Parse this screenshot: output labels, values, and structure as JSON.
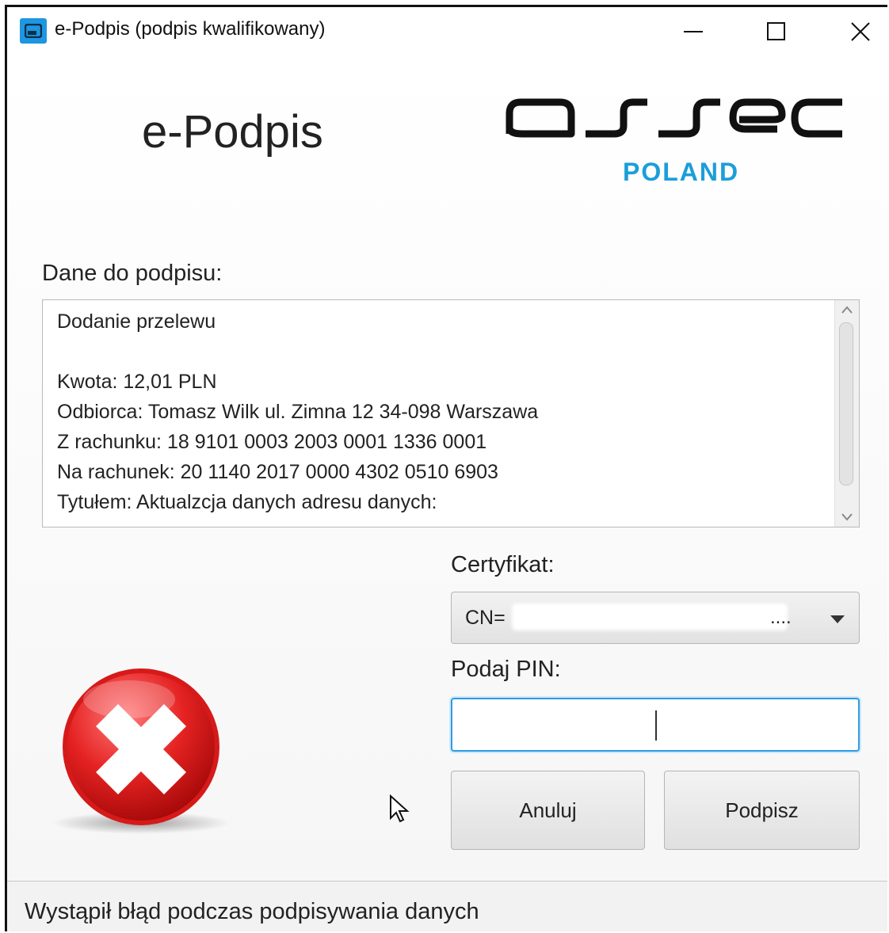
{
  "window": {
    "title": "e-Podpis (podpis kwalifikowany)",
    "icons": {
      "app": "app-window-icon",
      "minimize": "minimize-icon",
      "maximize": "maximize-icon",
      "close": "close-icon"
    }
  },
  "header": {
    "app_name": "e-Podpis",
    "brand": "asseco",
    "brand_sub": "POLAND",
    "brand_color": "#1b9ed9"
  },
  "data_section": {
    "label": "Dane do podpisu:",
    "lines": [
      "Dodanie przelewu",
      "",
      "Kwota: 12,01 PLN",
      "Odbiorca: Tomasz Wilk ul. Zimna 12 34-098 Warszawa",
      "Z rachunku: 18 9101 0003 2003 0001 1336 0001",
      "Na rachunek: 20 1140 2017 0000 4302 0510 6903",
      "Tytułem: Aktualzcja danych adresu danych:"
    ]
  },
  "certificate": {
    "label": "Certyfikat:",
    "value_prefix": "CN=",
    "value_suffix": "....",
    "icon": "chevron-down-icon"
  },
  "pin": {
    "label": "Podaj PIN:",
    "value": "",
    "focus_color": "#2f9be6"
  },
  "buttons": {
    "cancel": "Anuluj",
    "sign": "Podpisz"
  },
  "status": {
    "icon": "error-icon",
    "message": "Wystąpił błąd podczas podpisywania danych",
    "error_color": "#e02020"
  }
}
